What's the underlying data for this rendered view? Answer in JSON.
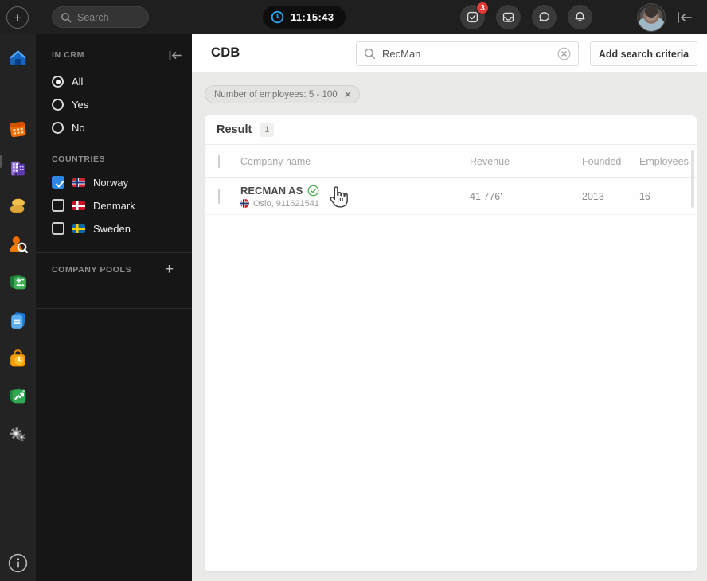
{
  "topbar": {
    "search_placeholder": "Search",
    "time": "11:15:43",
    "notifications_badge": "3"
  },
  "rail": {
    "icons": [
      "plus-icon",
      "home-icon",
      "calendar-icon",
      "companies-icon",
      "candidates-icon",
      "person-search-icon",
      "calculator-icon",
      "documents-icon",
      "time-bag-icon",
      "reports-icon",
      "settings-gears-icon",
      "info-icon"
    ]
  },
  "sidebar": {
    "in_crm": {
      "title": "IN CRM",
      "options": [
        {
          "label": "All",
          "selected": true
        },
        {
          "label": "Yes",
          "selected": false
        },
        {
          "label": "No",
          "selected": false
        }
      ]
    },
    "countries": {
      "title": "COUNTRIES",
      "items": [
        {
          "label": "Norway",
          "checked": true,
          "flag": "norway"
        },
        {
          "label": "Denmark",
          "checked": false,
          "flag": "denmark"
        },
        {
          "label": "Sweden",
          "checked": false,
          "flag": "sweden"
        }
      ]
    },
    "company_pools": {
      "title": "COMPANY POOLS",
      "add_label": "+"
    }
  },
  "main": {
    "title": "CDB",
    "search_value": "RecMan",
    "add_criteria_label": "Add search criteria",
    "filter_chip": {
      "text": "Number of employees: 5 - 100"
    },
    "result": {
      "label": "Result",
      "count": "1"
    },
    "table": {
      "columns": [
        "Company name",
        "Revenue",
        "Founded",
        "Employees"
      ],
      "rows": [
        {
          "name": "RECMAN AS",
          "verified": true,
          "location": "Oslo, 911621541",
          "revenue": "41 776'",
          "founded": "2013",
          "employees": "16"
        }
      ]
    }
  },
  "colors": {
    "accent_blue": "#2b87e3",
    "badge_red": "#e53935",
    "verified_green": "#4caf50",
    "topbar_bg": "#1f1f1f",
    "sidebar_bg": "#161616",
    "main_bg": "#eaeae8"
  }
}
